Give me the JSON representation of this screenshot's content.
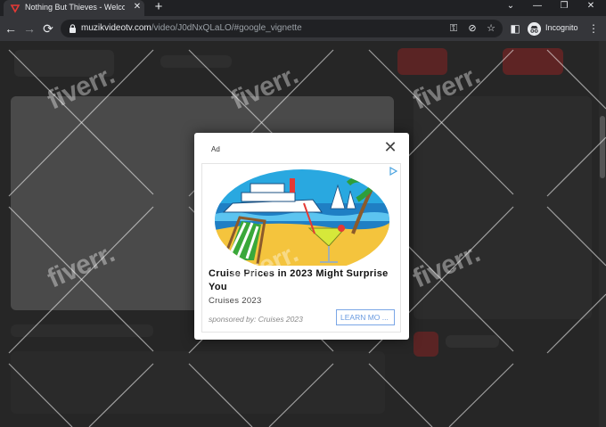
{
  "tab": {
    "title": "Nothing But Thieves - Welcome",
    "close": "✕"
  },
  "new_tab": "+",
  "window_controls": {
    "dropdown": "⌄",
    "minimize": "—",
    "restore": "❐",
    "close": "✕"
  },
  "nav": {
    "back": "←",
    "forward": "→",
    "reload": "⟳"
  },
  "address": {
    "host": "muzikvideotv.com",
    "path": "/video/J0dNxQLaLO/#google_vignette"
  },
  "toolbar": {
    "key": "⚿",
    "eye_off": "⊘",
    "star": "☆",
    "sidepanel": "◧",
    "incognito_label": "Incognito",
    "menu": "⋮"
  },
  "watermark": {
    "text": "fiverr."
  },
  "ad": {
    "label": "Ad",
    "close": "✕",
    "headline": "Cruise Prices in 2023 Might Surprise You",
    "subtitle": "Cruises 2023",
    "sponsor": "sponsored by: Cruises 2023",
    "cta": "LEARN MO ...",
    "colors": {
      "cta": "#6a9be0",
      "card": "#ffffff"
    }
  }
}
